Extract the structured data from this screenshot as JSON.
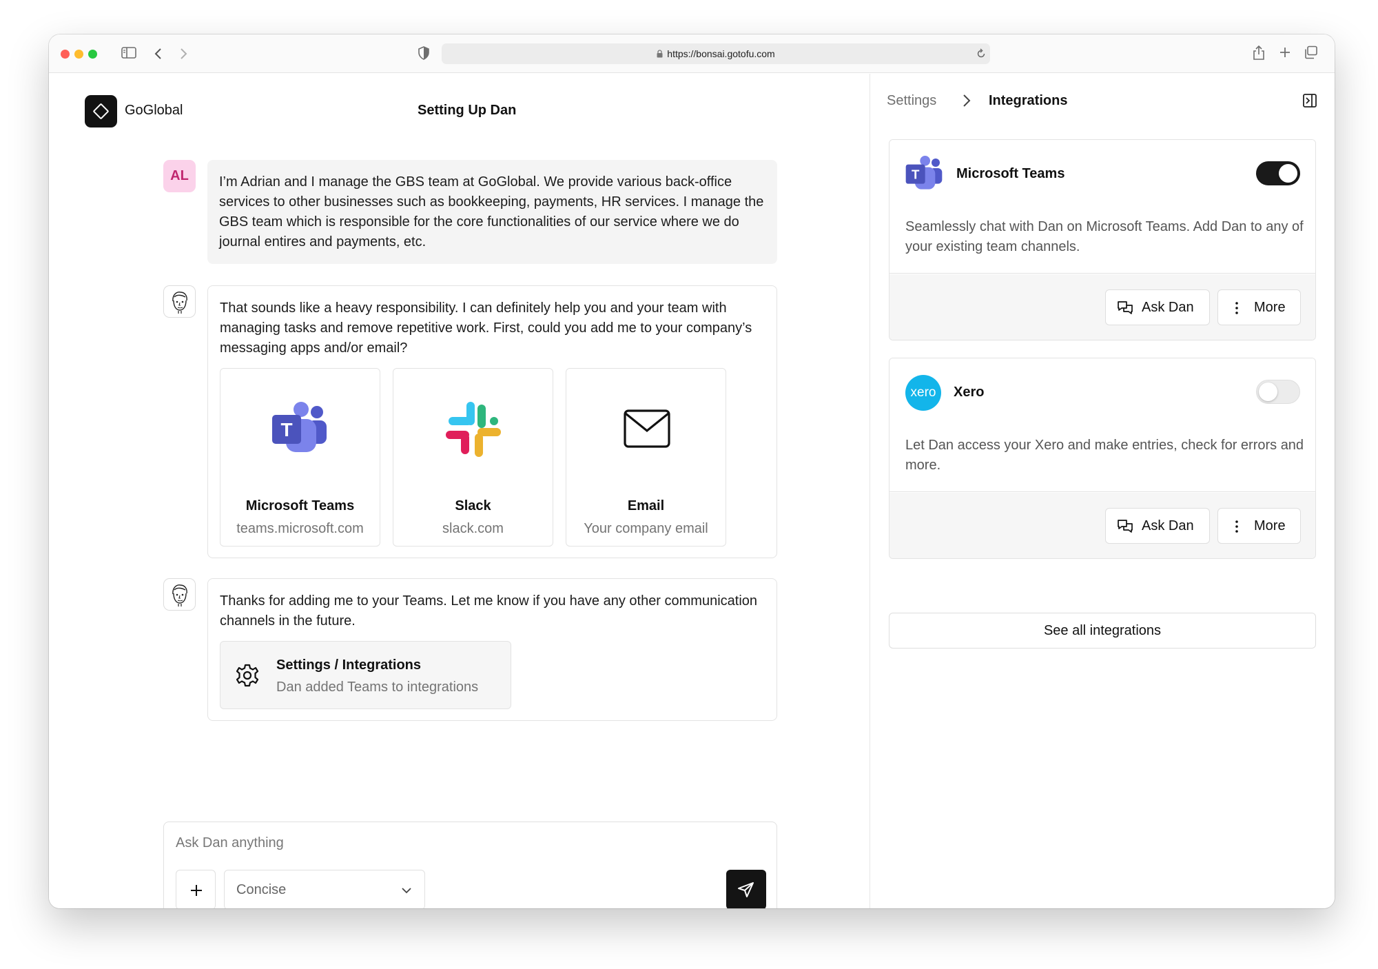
{
  "browser": {
    "url": "https://bonsai.gotofu.com",
    "traffic_lights": {
      "close": "#ff5f57",
      "minimize": "#febc2e",
      "zoom": "#28c840"
    }
  },
  "app": {
    "brand": "GoGlobal",
    "chat_title": "Setting Up Dan"
  },
  "chat": {
    "user_avatar_initials": "AL",
    "messages": [
      {
        "from": "user",
        "text": "I’m Adrian and I manage the GBS team at GoGlobal. We provide various back-office services to other businesses such as bookkeeping, payments, HR services. I manage the GBS team which is responsible for the core functionalities of our service where we do journal entires and payments, etc."
      },
      {
        "from": "dan",
        "text": "That sounds like a heavy responsibility. I can definitely help you and your team with managing tasks and remove repetitive work. First, could you add me to your company’s messaging apps and/or email?"
      },
      {
        "from": "dan",
        "text": "Thanks for adding me to your Teams. Let me know if you have any other communication channels in the future."
      }
    ],
    "integration_options": [
      {
        "title": "Microsoft Teams",
        "subtitle": "teams.microsoft.com",
        "icon": "microsoft-teams-icon"
      },
      {
        "title": "Slack",
        "subtitle": "slack.com",
        "icon": "slack-icon"
      },
      {
        "title": "Email",
        "subtitle": "Your company email",
        "icon": "envelope-icon"
      }
    ],
    "settings_chip": {
      "title": "Settings / Integrations",
      "subtitle": "Dan added Teams to integrations",
      "icon": "gear-icon"
    }
  },
  "composer": {
    "placeholder": "Ask Dan anything",
    "mode": "Concise"
  },
  "panel": {
    "breadcrumb_parent": "Settings",
    "breadcrumb_current": "Integrations",
    "integrations": [
      {
        "name": "Microsoft Teams",
        "enabled": true,
        "description": "Seamlessly chat with Dan on Microsoft Teams. Add Dan to any of your existing team channels.",
        "ask_label": "Ask Dan",
        "more_label": "More"
      },
      {
        "name": "Xero",
        "logo_text": "xero",
        "enabled": false,
        "description": "Let Dan access your Xero and make entries, check for errors and more.",
        "ask_label": "Ask Dan",
        "more_label": "More"
      }
    ],
    "see_all_label": "See all integrations"
  },
  "colors": {
    "user_avatar_bg": "#fbd2ea",
    "user_avatar_text": "#c0266f",
    "teams_purple": "#5059c9",
    "xero_blue": "#13b5ea",
    "dark": "#141414"
  }
}
